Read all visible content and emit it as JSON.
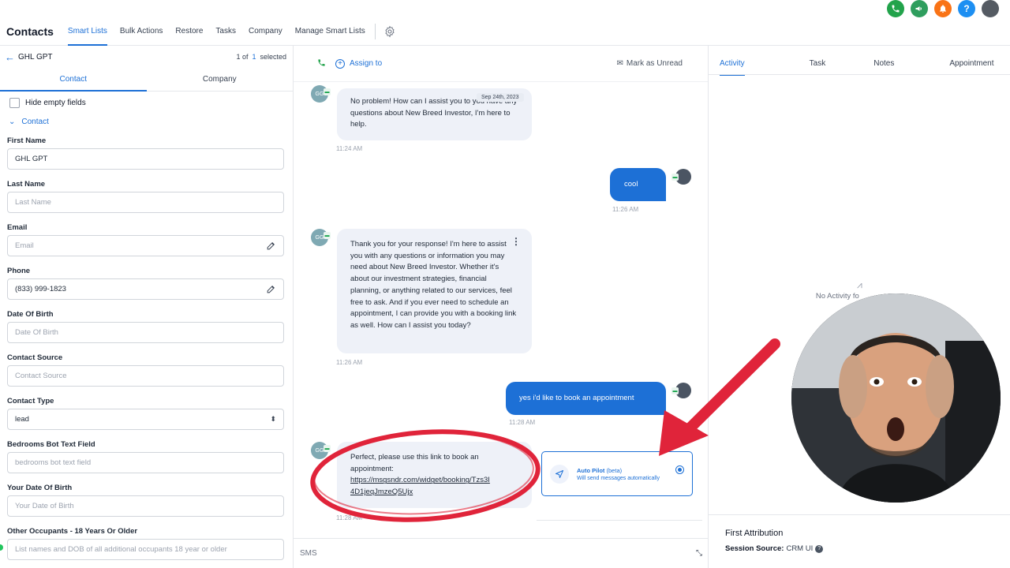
{
  "top_icons": [
    {
      "name": "phone-call-icon",
      "color": "#22a34b",
      "glyph": "✆"
    },
    {
      "name": "megaphone-icon",
      "color": "#2f9e5e",
      "glyph": "◀"
    },
    {
      "name": "bell-icon",
      "color": "#f97316",
      "glyph": "◆"
    },
    {
      "name": "help-icon",
      "color": "#1d8ff2",
      "glyph": "?"
    }
  ],
  "header": {
    "title": "Contacts",
    "nav": [
      "Smart Lists",
      "Bulk Actions",
      "Restore",
      "Tasks",
      "Company",
      "Manage Smart Lists"
    ],
    "active_nav": "Smart Lists"
  },
  "left": {
    "contact_name": "GHL GPT",
    "selection": {
      "current": "1 of",
      "total": "1",
      "suffix": "selected"
    },
    "tabs": [
      "Contact",
      "Company"
    ],
    "hide_empty_label": "Hide empty fields",
    "section_label": "Contact",
    "fields": [
      {
        "label": "First Name",
        "value": "GHL GPT",
        "placeholder": ""
      },
      {
        "label": "Last Name",
        "value": "",
        "placeholder": "Last Name"
      },
      {
        "label": "Email",
        "value": "",
        "placeholder": "Email"
      },
      {
        "label": "Phone",
        "value": "(833) 999-1823",
        "placeholder": ""
      },
      {
        "label": "Date Of Birth",
        "value": "",
        "placeholder": "Date Of Birth"
      },
      {
        "label": "Contact Source",
        "value": "",
        "placeholder": "Contact Source"
      },
      {
        "label": "Contact Type",
        "value": "lead",
        "placeholder": ""
      },
      {
        "label": "Bedrooms Bot Text Field",
        "value": "",
        "placeholder": "bedrooms bot text field"
      },
      {
        "label": "Your Date Of Birth",
        "value": "",
        "placeholder": "Your Date of Birth"
      },
      {
        "label": "Other Occupants - 18 Years Or Older",
        "value": "",
        "placeholder": "List names and DOB of all additional occupants 18 year or older"
      }
    ]
  },
  "middle": {
    "assign_label": "Assign to",
    "mark_unread_label": "Mark as Unread",
    "avatar_initials": "GG",
    "date_chip": "Sep 24th, 2023",
    "messages": [
      {
        "dir": "in",
        "text": "No problem! How can I assist you to you have any questions about New Breed Investor, I'm here to help.",
        "time": "11:24 AM"
      },
      {
        "dir": "out",
        "text": "cool",
        "time": "11:26 AM"
      },
      {
        "dir": "in",
        "text": "Thank you for your response! I'm here to assist you with any questions or information you may need about New Breed Investor. Whether it's about our investment strategies, financial planning, or anything related to our services, feel free to ask. And if you ever need to schedule an appointment, I can provide you with a booking link as well. How can I assist you today?",
        "time": "11:26 AM"
      },
      {
        "dir": "out",
        "text": "yes i'd like to book an appointment",
        "time": "11:28 AM"
      },
      {
        "dir": "in",
        "text": "Perfect, please use this link to book an appointment:",
        "link": "https://msgsndr.com/widget/booking/Tzs3I4D1jeqJmzeQ5Ujx",
        "link_line1": "https://msgsndr.com/widget/booking/Tzs3I",
        "link_line2": "4D1jeqJmzeQ5Ujx",
        "time": "11:28 AM"
      }
    ],
    "autopilot": {
      "title": "Auto Pilot",
      "beta": "(beta)",
      "subtitle": "Will send messages automatically"
    },
    "composer_channel": "SMS"
  },
  "right": {
    "tabs": [
      "Activity",
      "Task",
      "Notes",
      "Appointment"
    ],
    "active_tab": "Activity",
    "empty_text": "No Activity fo",
    "first_attribution": "First Attribution",
    "session_source_label": "Session Source:",
    "session_source_value": "CRM UI"
  },
  "overlay": {
    "annotation_color": "#e0243a"
  }
}
